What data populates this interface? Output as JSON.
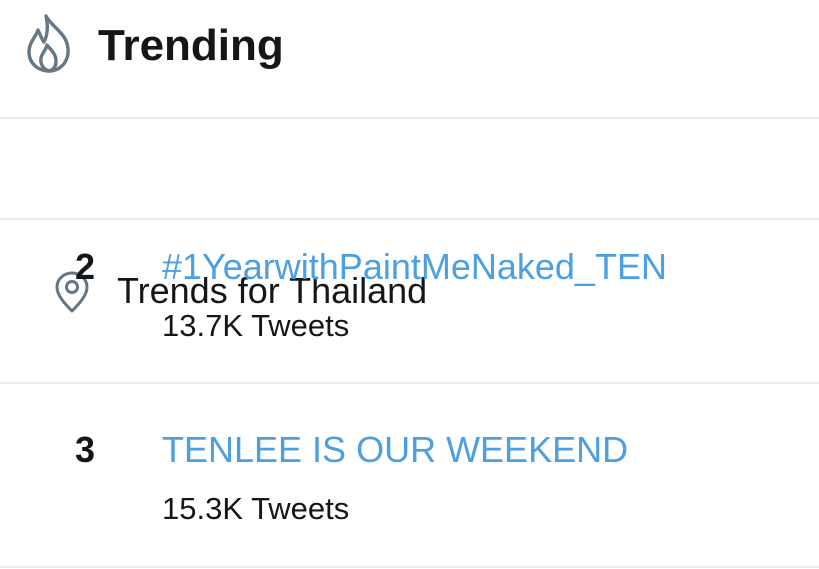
{
  "header": {
    "title": "Trending",
    "icon": "flame-icon"
  },
  "location": {
    "icon": "location-pin-icon",
    "label": "Trends for Thailand"
  },
  "trends": [
    {
      "rank": "2",
      "name": "#1YearwithPaintMeNaked_TEN",
      "count": "13.7K Tweets"
    },
    {
      "rank": "3",
      "name": "TENLEE IS OUR WEEKEND",
      "count": "15.3K Tweets"
    }
  ],
  "colors": {
    "link": "#4c9fe0",
    "text": "#14171a",
    "icon": "#657786",
    "divider": "#e6ecf0"
  }
}
